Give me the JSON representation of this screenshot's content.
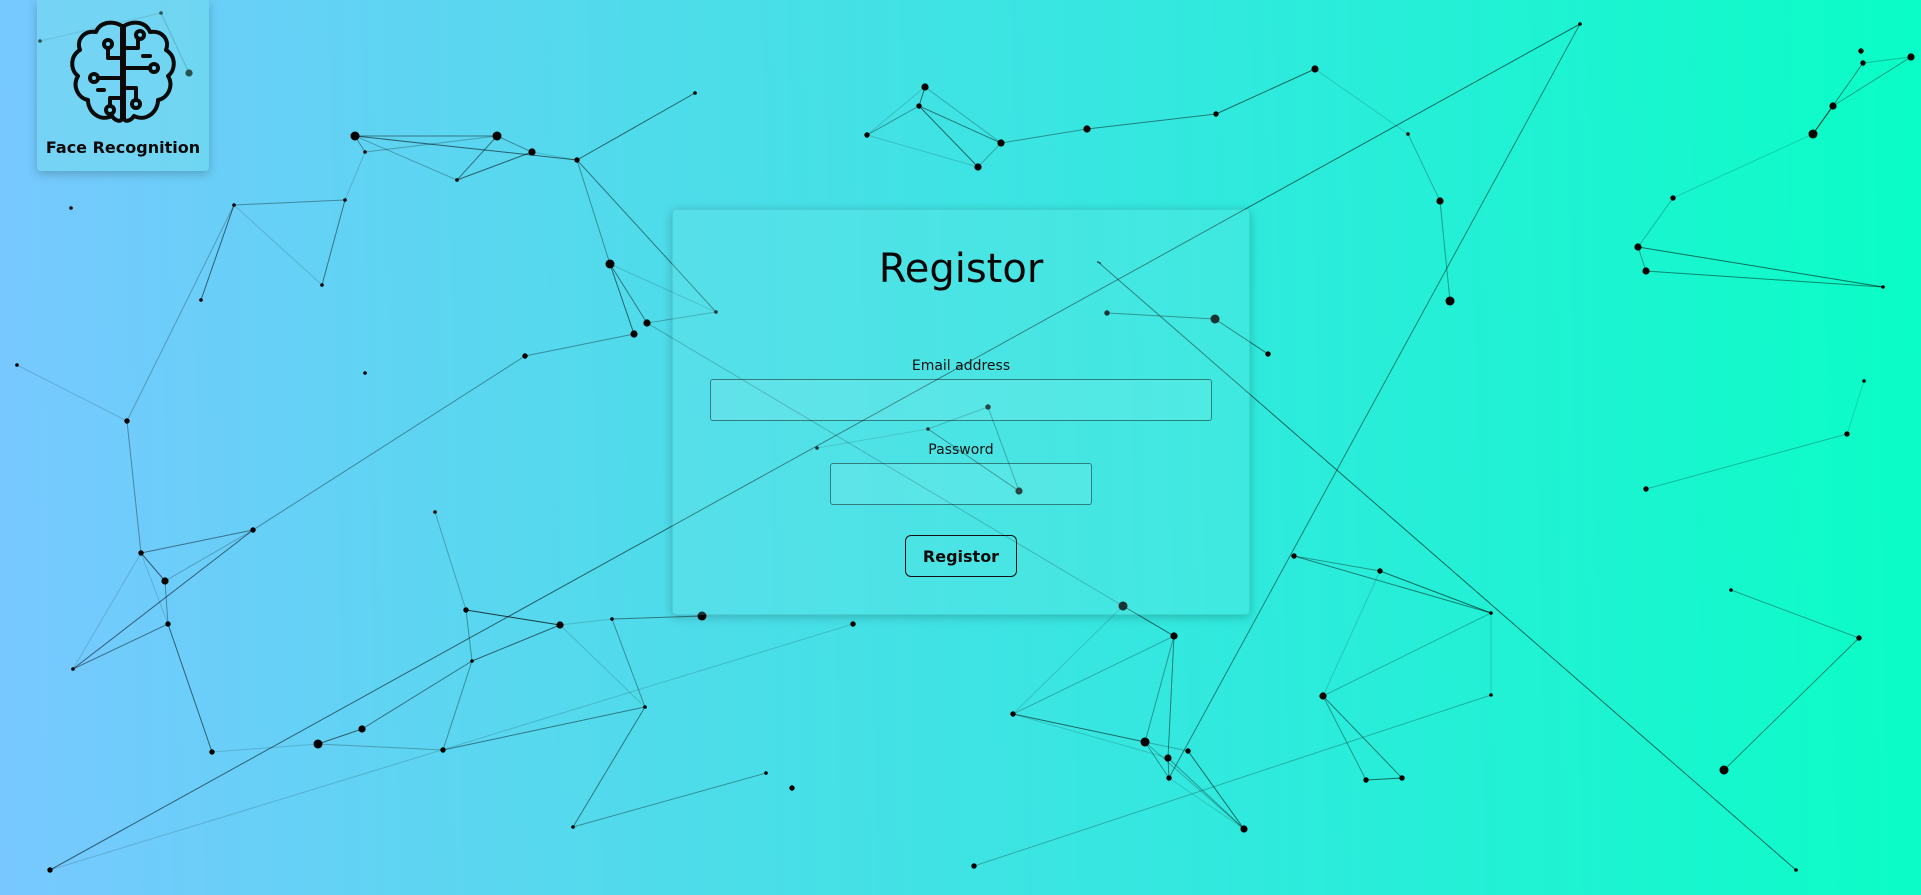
{
  "brand": {
    "logo_icon": "brain-circuit-icon",
    "name": "Face Recognition"
  },
  "form": {
    "title": "Registor",
    "email_label": "Email address",
    "email_value": "",
    "password_label": "Password",
    "password_value": "",
    "submit_label": "Registor"
  },
  "background": {
    "gradient_start": "#78c8ff",
    "gradient_end": "#0afdc6",
    "particle_color": "#000000"
  }
}
